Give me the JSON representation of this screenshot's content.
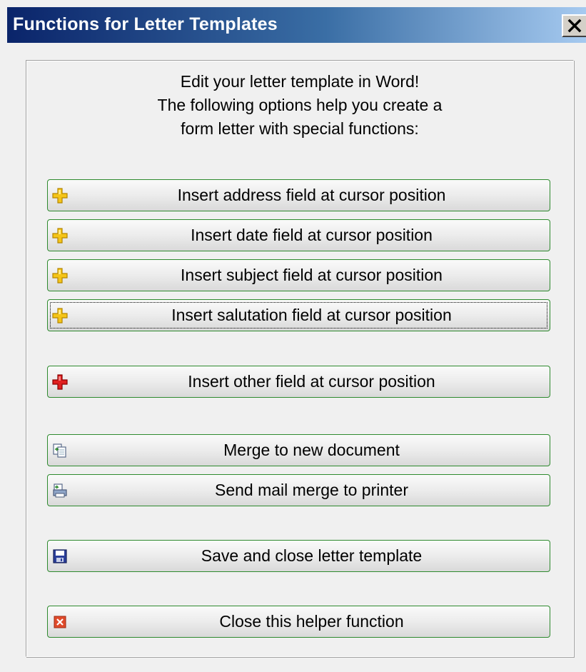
{
  "window": {
    "title": "Functions for Letter Templates",
    "close_glyph": "✕"
  },
  "intro": {
    "line1": "Edit your letter template in Word!",
    "line2": "The following options help you create a",
    "line3": "form letter with special functions:"
  },
  "buttons": {
    "address": {
      "label": "Insert address field at cursor position",
      "icon": "yellow-plus-icon"
    },
    "date": {
      "label": "Insert date field at cursor position",
      "icon": "yellow-plus-icon"
    },
    "subject": {
      "label": "Insert subject field at cursor position",
      "icon": "yellow-plus-icon"
    },
    "salutation": {
      "label": "Insert salutation field at cursor position",
      "icon": "yellow-plus-icon"
    },
    "other": {
      "label": "Insert other field at cursor position",
      "icon": "red-plus-icon"
    },
    "merge_new": {
      "label": "Merge to new document",
      "icon": "merge-document-icon"
    },
    "merge_print": {
      "label": "Send mail merge to printer",
      "icon": "print-merge-icon"
    },
    "save_close": {
      "label": "Save and close letter template",
      "icon": "floppy-disk-icon"
    },
    "close_helper": {
      "label": "Close this helper function",
      "icon": "red-x-icon"
    }
  },
  "colors": {
    "title_gradient_start": "#0a246a",
    "title_gradient_end": "#a6caf0",
    "button_border": "#2e8a2e",
    "yellow_plus": "#f5c518",
    "red_plus": "#e02020",
    "close_red": "#e04a2a"
  }
}
